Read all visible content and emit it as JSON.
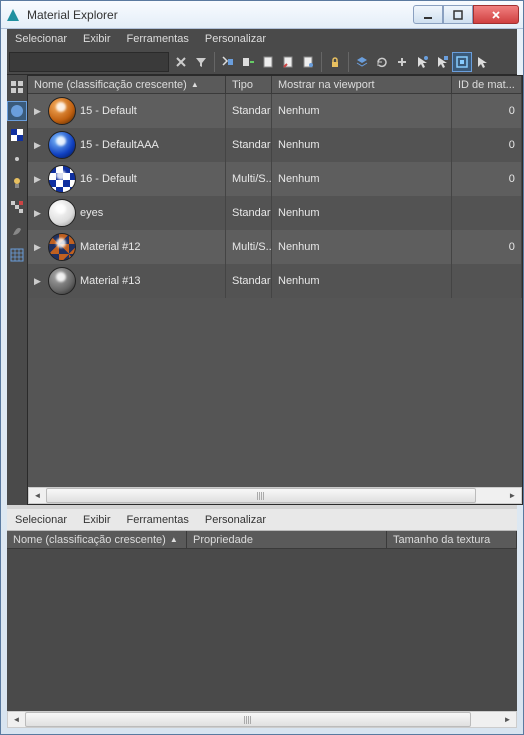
{
  "window": {
    "title": "Material Explorer"
  },
  "menus_top": [
    "Selecionar",
    "Exibir",
    "Ferramentas",
    "Personalizar"
  ],
  "menus_bottom": [
    "Selecionar",
    "Exibir",
    "Ferramentas",
    "Personalizar"
  ],
  "columns_top": {
    "name": "Nome (classificação crescente)",
    "type": "Tipo",
    "viewport": "Mostrar na viewport",
    "id": "ID de mat..."
  },
  "columns_bottom": {
    "name": "Nome (classificação crescente)",
    "prop": "Propriedade",
    "tex": "Tamanho da textura"
  },
  "materials": [
    {
      "name": "15 - Default",
      "type": "Standard",
      "viewport": "Nenhum",
      "id": "0",
      "swatch": "sw-orange"
    },
    {
      "name": "15 - DefaultAAA",
      "type": "Standard",
      "viewport": "Nenhum",
      "id": "0",
      "swatch": "sw-blue"
    },
    {
      "name": "16 - Default",
      "type": "Multi/S...",
      "viewport": "Nenhum",
      "id": "0",
      "swatch": "sw-checker"
    },
    {
      "name": "eyes",
      "type": "Standard",
      "viewport": "Nenhum",
      "id": "",
      "swatch": "sw-white"
    },
    {
      "name": "Material #12",
      "type": "Multi/S...",
      "viewport": "Nenhum",
      "id": "0",
      "swatch": "sw-checker2"
    },
    {
      "name": "Material #13",
      "type": "Standard",
      "viewport": "Nenhum",
      "id": "",
      "swatch": "sw-grey"
    }
  ]
}
